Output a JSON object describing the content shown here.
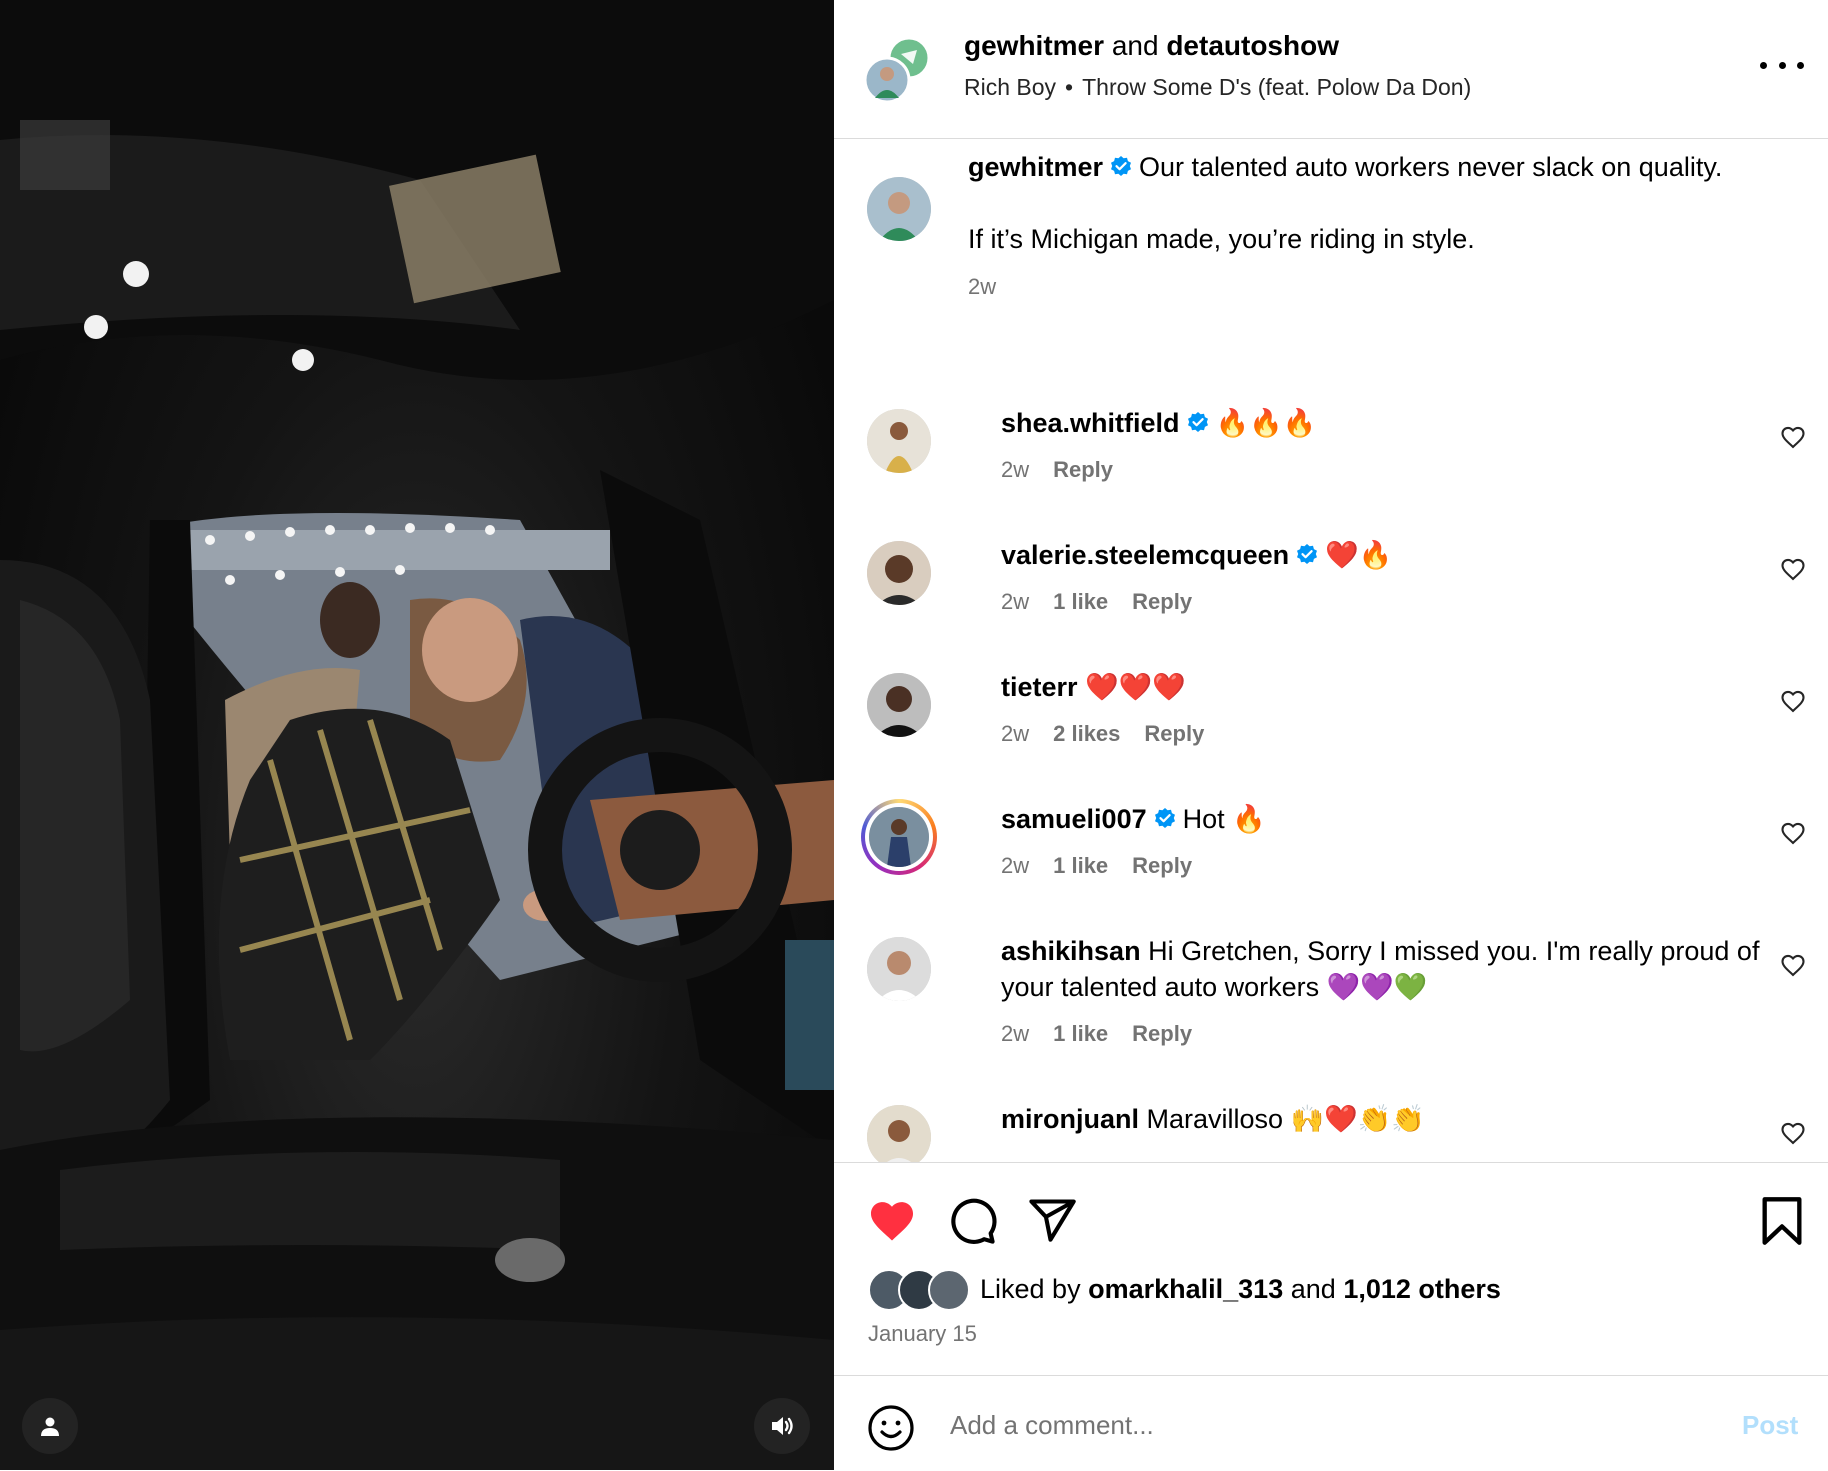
{
  "post": {
    "header": {
      "author": "gewhitmer",
      "joiner": "and",
      "collaborator": "detautoshow",
      "audio_artist": "Rich Boy",
      "audio_separator": "•",
      "audio_track": "Throw Some D's (feat. Polow Da Don)"
    },
    "caption": {
      "username": "gewhitmer",
      "verified": true,
      "line1": "Our talented auto workers never slack on quality.",
      "line2": "If it’s Michigan made, you’re riding in style.",
      "time": "2w"
    },
    "comments": [
      {
        "username": "shea.whitfield",
        "verified": true,
        "text": "🔥🔥🔥",
        "time": "2w",
        "likes": "",
        "reply": "Reply"
      },
      {
        "username": "valerie.steelemcqueen",
        "verified": true,
        "text": "❤️🔥",
        "time": "2w",
        "likes": "1 like",
        "reply": "Reply"
      },
      {
        "username": "tieterr",
        "verified": false,
        "text": "❤️❤️❤️",
        "time": "2w",
        "likes": "2 likes",
        "reply": "Reply"
      },
      {
        "username": "samueli007",
        "verified": true,
        "text": "Hot 🔥",
        "time": "2w",
        "likes": "1 like",
        "reply": "Reply"
      },
      {
        "username": "ashikihsan",
        "verified": false,
        "text": "Hi Gretchen, Sorry I missed you. I'm really proud of your talented auto workers 💜💜💚",
        "time": "2w",
        "likes": "1 like",
        "reply": "Reply"
      },
      {
        "username": "mironjuanl",
        "verified": false,
        "text": "Maravilloso 🙌❤️👏👏",
        "time": "",
        "likes": "",
        "reply": ""
      }
    ],
    "liked_by": {
      "prefix": "Liked by",
      "user": "omarkhalil_313",
      "joiner": "and",
      "others": "1,012 others"
    },
    "date": "January 15",
    "composer": {
      "placeholder": "Add a comment...",
      "post_label": "Post"
    }
  },
  "icons": {
    "like": "heart-filled-icon",
    "comment": "comment-bubble-icon",
    "share": "paper-plane-icon",
    "save": "bookmark-icon",
    "emoji": "smiley-icon",
    "more": "more-options-icon",
    "media_user": "user-tag-icon",
    "media_sound": "speaker-icon"
  },
  "colors": {
    "like_red": "#ff3040",
    "verified_blue": "#0095f6",
    "post_disabled": "#b2dffc",
    "muted_text": "#737373"
  }
}
